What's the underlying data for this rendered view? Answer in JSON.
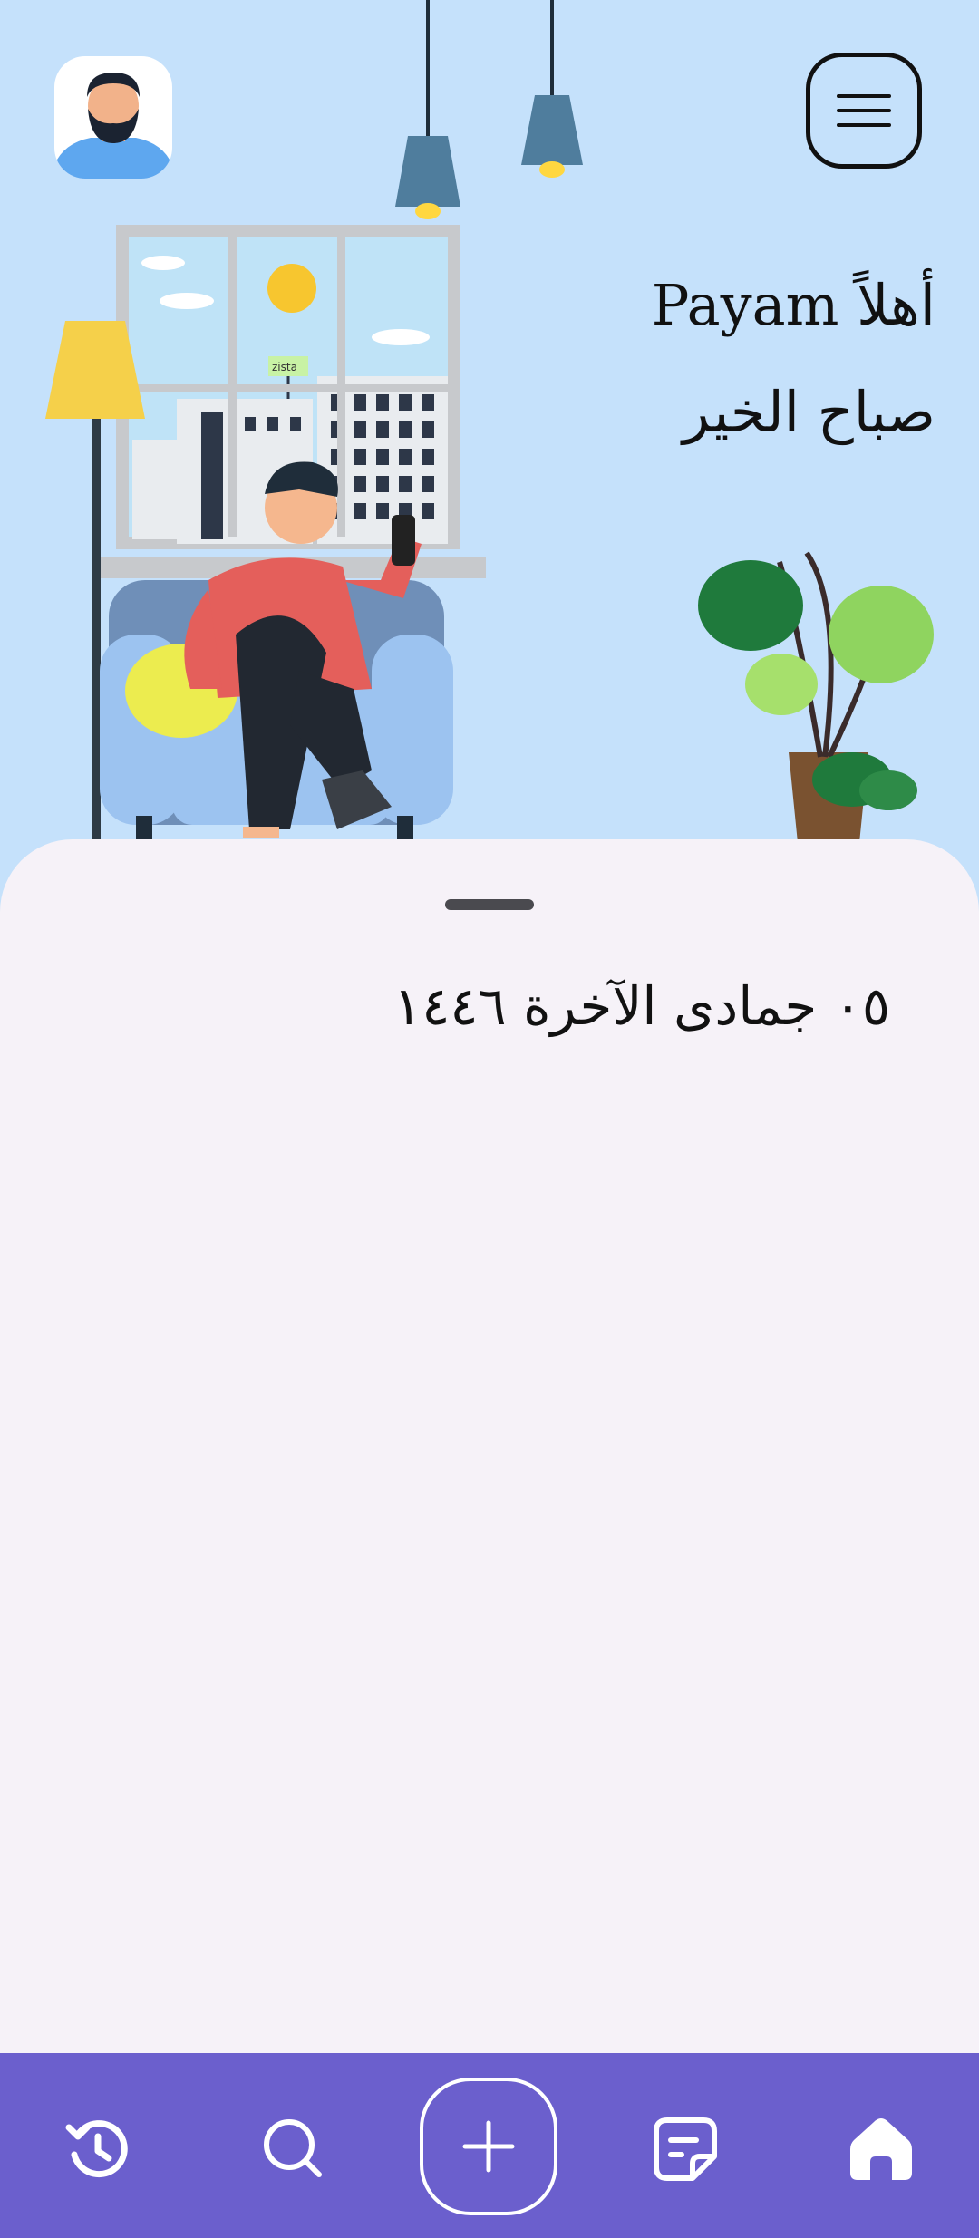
{
  "header": {
    "greeting_hello": "أهلاً Payam",
    "greeting_morning": "صباح الخير",
    "avatar_icon": "user-avatar-icon",
    "menu_icon": "hamburger-menu-icon"
  },
  "illustration": {
    "sign_text": "zista"
  },
  "sheet": {
    "date": "٠٥ جمادی الآخرة ١٤٤٦"
  },
  "bottom_nav": {
    "items": [
      {
        "icon": "history-icon"
      },
      {
        "icon": "search-icon"
      },
      {
        "icon": "add-icon"
      },
      {
        "icon": "note-icon"
      },
      {
        "icon": "home-icon"
      }
    ]
  },
  "colors": {
    "background": "#c5e1fb",
    "sheet": "#f6f2f8",
    "nav": "#6b5fcd"
  }
}
